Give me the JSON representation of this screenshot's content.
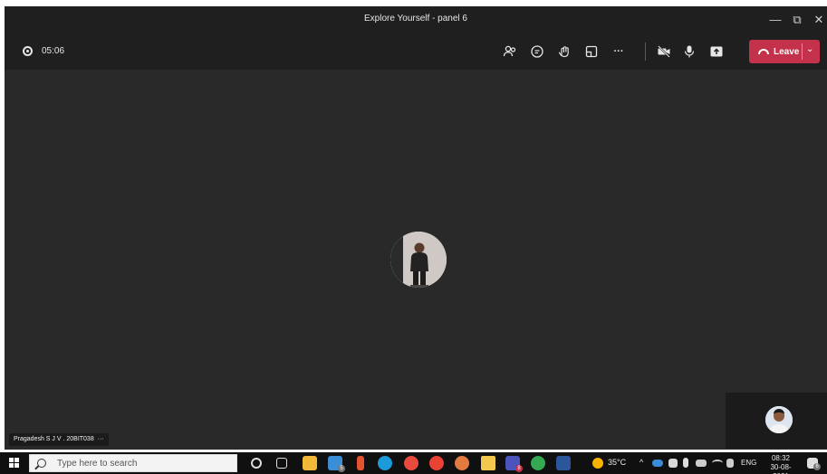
{
  "window": {
    "title": "Explore Yourself - panel 6",
    "controls": {
      "minimize": "—",
      "restore": "⧉",
      "close": "✕"
    }
  },
  "toolbar": {
    "timer": "05:06",
    "icons": [
      "participants-icon",
      "chat-icon",
      "reactions-icon",
      "rooms-icon",
      "more-icon",
      "camera-off-icon",
      "mic-icon",
      "share-icon"
    ],
    "more_label": "···",
    "leave_label": "Leave",
    "leave_color": "#c4314b"
  },
  "stage": {
    "participant_name": "Pragadesh S J V . 20BIT038",
    "name_more": "···"
  },
  "taskbar": {
    "search_placeholder": "Type here to search",
    "badges": {
      "mail": "5",
      "teams": "8"
    },
    "weather": "35°C",
    "caret": "^",
    "language": "ENG",
    "time": "08:32",
    "date": "30-08-2021",
    "notification_count": "6"
  }
}
